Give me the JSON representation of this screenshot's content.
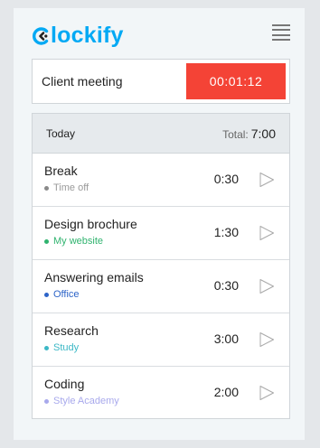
{
  "app": {
    "name": "lockify",
    "accent": "#03a9f4"
  },
  "timer": {
    "description": "Client meeting",
    "elapsed": "00:01:12",
    "button_color": "#f44336"
  },
  "list": {
    "header_label": "Today",
    "total_label": "Total:",
    "total_value": "7:00",
    "entries": [
      {
        "title": "Break",
        "project": "Time off",
        "project_color": "#9a9a9a",
        "dot_color": "#8a8a8a",
        "duration": "0:30"
      },
      {
        "title": "Design brochure",
        "project": "My website",
        "project_color": "#2fb36e",
        "dot_color": "#2fb36e",
        "duration": "1:30"
      },
      {
        "title": "Answering emails",
        "project": "Office",
        "project_color": "#2d64c8",
        "dot_color": "#2d64c8",
        "duration": "0:30"
      },
      {
        "title": "Research",
        "project": "Study",
        "project_color": "#3cb8c6",
        "dot_color": "#3cb8c6",
        "duration": "3:00"
      },
      {
        "title": "Coding",
        "project": "Style Academy",
        "project_color": "#a8a9ec",
        "dot_color": "#a8a9ec",
        "duration": "2:00"
      }
    ]
  },
  "icons": {
    "menu": "hamburger-icon",
    "play": "play-icon",
    "logo": "clockify-logo-icon"
  }
}
